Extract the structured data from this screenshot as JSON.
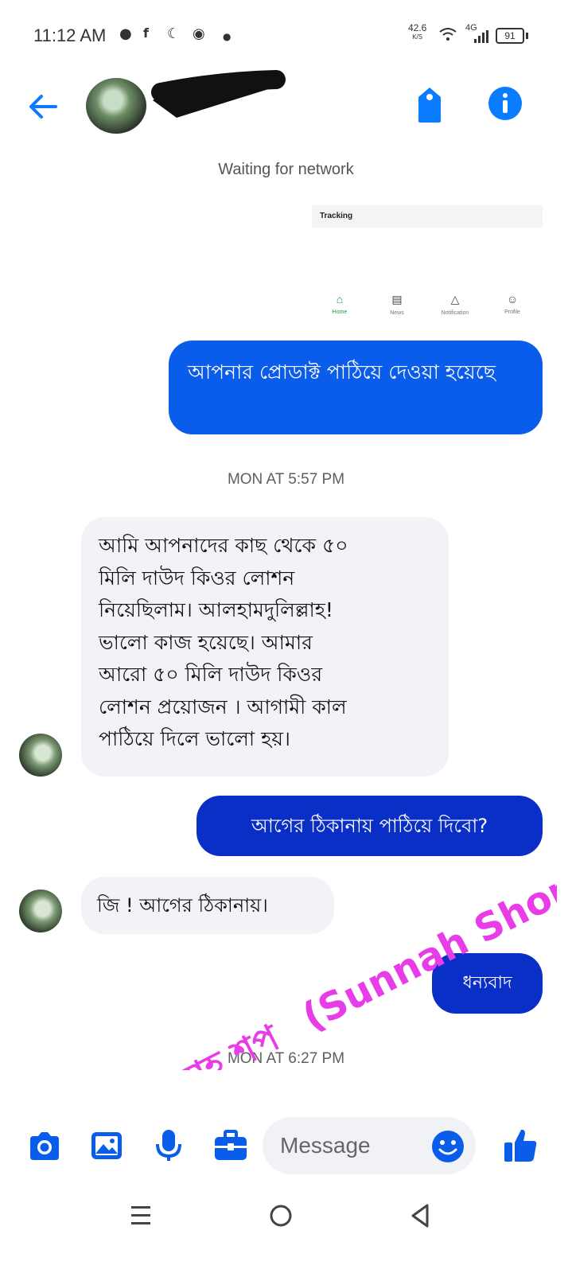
{
  "status_bar": {
    "time": "11:12 AM",
    "net_speed_value": "42.6",
    "net_speed_unit": "K/S",
    "network_type": "4G",
    "battery": "91"
  },
  "header": {
    "network_status": "Waiting for network"
  },
  "shared_image": {
    "title": "Tracking",
    "tabs": [
      {
        "label": "Home",
        "icon": "home-icon"
      },
      {
        "label": "News",
        "icon": "news-icon"
      },
      {
        "label": "Notification",
        "icon": "bell-icon"
      },
      {
        "label": "Profile",
        "icon": "profile-icon"
      }
    ]
  },
  "messages": [
    {
      "direction": "outgoing",
      "text": "আপনার প্রোডাক্ট পাঠিয়ে দেওয়া হয়েছে"
    },
    {
      "type": "timestamp",
      "text": "MON AT 5:57 PM"
    },
    {
      "direction": "incoming",
      "lines": [
        "আমি আপনাদের কাছ থেকে ৫০",
        "মিলি দাউদ কিওর লোশন",
        "নিয়েছিলাম। আলহামদুলিল্লাহ!",
        "ভালো কাজ হয়েছে। আমার",
        "আরো ৫০ মিলি দাউদ কিওর",
        "লোশন প্রয়োজন । আগামী কাল",
        "পাঠিয়ে দিলে ভালো হয়।"
      ]
    },
    {
      "direction": "outgoing",
      "text": "আগের ঠিকানায় পাঠিয়ে দিবো?"
    },
    {
      "direction": "incoming",
      "text": "জি ! আগের ঠিকানায়।"
    },
    {
      "direction": "outgoing",
      "text": "ধন্যবাদ"
    },
    {
      "type": "timestamp",
      "text": "MON AT 6:27 PM"
    }
  ],
  "watermark": {
    "text_bn": "সুন্নাহ শপ",
    "text_en": "(Sunnah Shop)",
    "color": "#e83ce8"
  },
  "composer": {
    "placeholder": "Message",
    "tools": [
      "camera-icon",
      "gallery-icon",
      "microphone-icon",
      "briefcase-icon"
    ]
  },
  "colors": {
    "accent": "#0a7cff",
    "outgoing_bubble": "#0a5cea",
    "outgoing_bubble_dark": "#0a2fc7",
    "incoming_bubble": "#f2f3f7"
  }
}
